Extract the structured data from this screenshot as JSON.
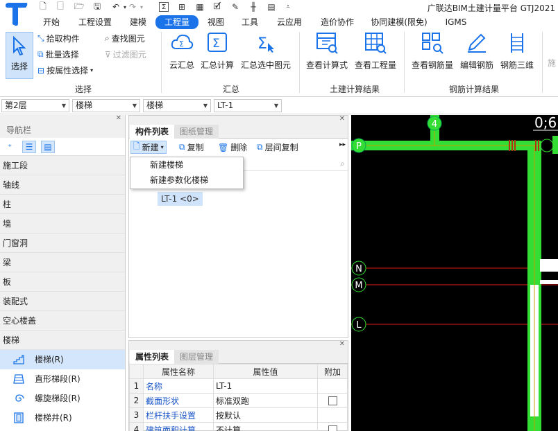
{
  "app": {
    "title": "广联达BIM土建计量平台 GTJ2021"
  },
  "menu": {
    "tabs": [
      "开始",
      "工程设置",
      "建模",
      "工程量",
      "视图",
      "工具",
      "云应用",
      "造价协作",
      "协同建模(限免)",
      "IGMS"
    ],
    "active": "工程量"
  },
  "ribbon": {
    "select_group": {
      "label": "选择",
      "select_btn": "选择",
      "pick": "拾取构件",
      "batch": "批量选择",
      "by_attr": "按属性选择",
      "find": "查找图元",
      "filter": "过滤图元"
    },
    "summary_group": {
      "label": "汇总",
      "cloud": "云汇总",
      "calc": "汇总计算",
      "calc_selected": "汇总选中图元"
    },
    "civil_group": {
      "label": "土建计算结果",
      "view_formula": "查看计算式",
      "view_qty": "查看工程量"
    },
    "rebar_group": {
      "label": "钢筋计算结果",
      "view_rebar": "查看钢筋量",
      "edit_rebar": "编辑钢筋",
      "rebar_3d": "钢筋三维"
    },
    "overflow": "施"
  },
  "selectors": {
    "floor": "第2层",
    "category": "楼梯",
    "type": "楼梯",
    "component": "LT-1"
  },
  "nav": {
    "title": "导航栏",
    "categories": [
      "施工段",
      "轴线",
      "柱",
      "墙",
      "门窗洞",
      "梁",
      "板",
      "装配式",
      "空心楼盖",
      "楼梯"
    ],
    "sub_items": [
      "楼梯(R)",
      "直形梯段(R)",
      "螺旋梯段(R)",
      "楼梯井(R)"
    ]
  },
  "component_panel": {
    "tabs": [
      "构件列表",
      "图纸管理"
    ],
    "tools": {
      "new": "新建",
      "copy": "复制",
      "delete": "删除",
      "floor_copy": "层间复制"
    },
    "dropdown": [
      "新建楼梯",
      "新建参数化楼梯"
    ],
    "tree_item": "LT-1 <0>"
  },
  "property_panel": {
    "tabs": [
      "属性列表",
      "图层管理"
    ],
    "headers": [
      "属性名称",
      "属性值",
      "附加"
    ],
    "rows": [
      {
        "num": "1",
        "name": "名称",
        "value": "LT-1",
        "check": false
      },
      {
        "num": "2",
        "name": "截面形状",
        "value": "标准双跑",
        "check": true
      },
      {
        "num": "3",
        "name": "栏杆扶手设置",
        "value": "按默认",
        "check": false
      },
      {
        "num": "4",
        "name": "建筑面积计算",
        "value": "不计算",
        "check": true
      }
    ]
  },
  "canvas": {
    "axis_labels": [
      "4",
      "P",
      "N",
      "M",
      "L"
    ],
    "dim_text": "0;6",
    "colors": {
      "wall": "#33dd33",
      "axis_line": "#e01818",
      "background": "#000000"
    }
  }
}
